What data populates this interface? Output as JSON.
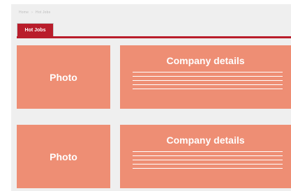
{
  "breadcrumb": {
    "home": "Home",
    "separator": "›",
    "current": "Hot Jobs"
  },
  "tabs": [
    {
      "label": "Hot Jobs",
      "active": true
    }
  ],
  "colors": {
    "accent": "#b91d2b",
    "card": "#ee8e74",
    "background": "#efefef"
  },
  "listings": [
    {
      "photo_label": "Photo",
      "details_title": "Company details"
    },
    {
      "photo_label": "Photo",
      "details_title": "Company details"
    }
  ]
}
